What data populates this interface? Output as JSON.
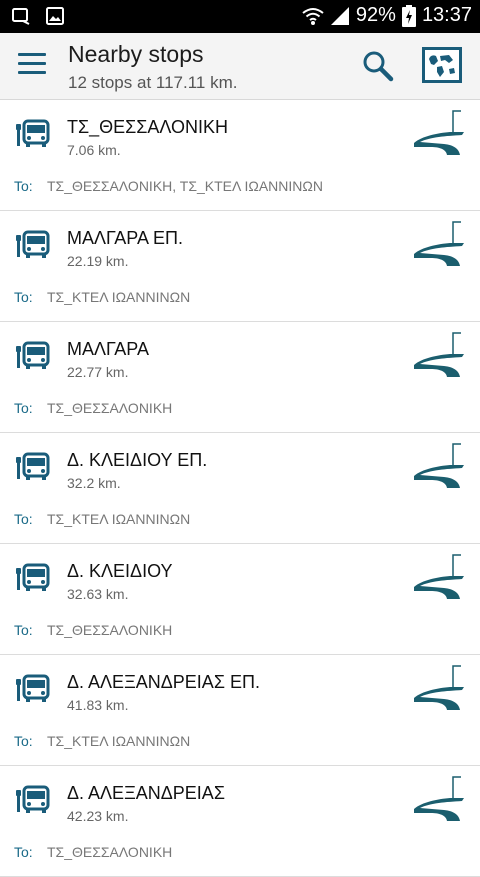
{
  "status_bar": {
    "battery": "92%",
    "time": "13:37"
  },
  "app_bar": {
    "title": "Nearby stops",
    "subtitle": "12 stops at 117.11 km."
  },
  "to_label": "To:",
  "stops": [
    {
      "name": "ΤΣ_ΘΕΣΣΑΛΟΝΙΚΗ",
      "distance": "7.06 km.",
      "to": "ΤΣ_ΘΕΣΣΑΛΟΝΙΚΗ, ΤΣ_ΚΤΕΛ ΙΩΑΝΝΙΝΩΝ"
    },
    {
      "name": "ΜΑΛΓΑΡΑ ΕΠ.",
      "distance": "22.19 km.",
      "to": "ΤΣ_ΚΤΕΛ ΙΩΑΝΝΙΝΩΝ"
    },
    {
      "name": "ΜΑΛΓΑΡΑ",
      "distance": "22.77 km.",
      "to": "ΤΣ_ΘΕΣΣΑΛΟΝΙΚΗ"
    },
    {
      "name": "Δ. ΚΛΕΙΔΙΟΥ ΕΠ.",
      "distance": "32.2 km.",
      "to": "ΤΣ_ΚΤΕΛ ΙΩΑΝΝΙΝΩΝ"
    },
    {
      "name": "Δ. ΚΛΕΙΔΙΟΥ",
      "distance": "32.63 km.",
      "to": "ΤΣ_ΘΕΣΣΑΛΟΝΙΚΗ"
    },
    {
      "name": "Δ. ΑΛΕΞΑΝΔΡΕΙΑΣ ΕΠ.",
      "distance": "41.83 km.",
      "to": "ΤΣ_ΚΤΕΛ ΙΩΑΝΝΙΝΩΝ"
    },
    {
      "name": "Δ. ΑΛΕΞΑΝΔΡΕΙΑΣ",
      "distance": "42.23 km.",
      "to": "ΤΣ_ΘΕΣΣΑΛΟΝΙΚΗ"
    }
  ],
  "colors": {
    "accent": "#1a5c7a",
    "route_icon": "#1b5e6e",
    "to_label": "#1a6a88"
  },
  "icons": {
    "menu": "hamburger-icon",
    "search": "search-icon",
    "map": "map-icon",
    "stop": "bus-stop-icon",
    "route": "route-icon"
  }
}
